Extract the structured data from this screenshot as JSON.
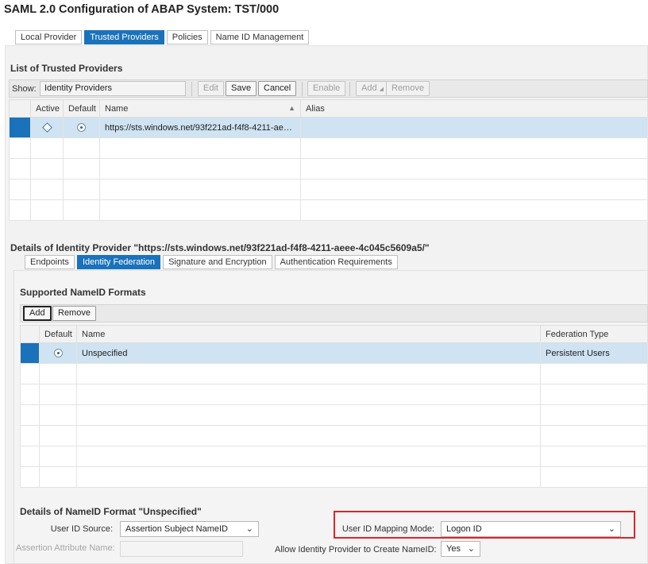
{
  "page_title": "SAML 2.0 Configuration of ABAP System: TST/000",
  "main_tabs": [
    {
      "label": "Local Provider",
      "active": false
    },
    {
      "label": "Trusted Providers",
      "active": true
    },
    {
      "label": "Policies",
      "active": false
    },
    {
      "label": "Name ID Management",
      "active": false
    }
  ],
  "trusted": {
    "title": "List of Trusted Providers",
    "show_label": "Show:",
    "show_value": "Identity Providers",
    "buttons": {
      "edit": "Edit",
      "save": "Save",
      "cancel": "Cancel",
      "enable": "Enable",
      "add": "Add",
      "remove": "Remove"
    },
    "columns": {
      "active": "Active",
      "default": "Default",
      "name": "Name",
      "alias": "Alias"
    },
    "rows": [
      {
        "name": "https://sts.windows.net/93f221ad-f4f8-4211-aeee-4...",
        "alias": ""
      }
    ]
  },
  "details": {
    "title": "Details of Identity Provider \"https://sts.windows.net/93f221ad-f4f8-4211-aeee-4c045c5609a5/\"",
    "tabs": [
      {
        "label": "Endpoints",
        "active": false
      },
      {
        "label": "Identity Federation",
        "active": true
      },
      {
        "label": "Signature and Encryption",
        "active": false
      },
      {
        "label": "Authentication Requirements",
        "active": false
      }
    ]
  },
  "nameid": {
    "title": "Supported NameID Formats",
    "buttons": {
      "add": "Add",
      "remove": "Remove"
    },
    "columns": {
      "default": "Default",
      "name": "Name",
      "federation_type": "Federation Type"
    },
    "rows": [
      {
        "name": "Unspecified",
        "federation_type": "Persistent Users"
      }
    ]
  },
  "format_details": {
    "title": "Details of NameID Format \"Unspecified\"",
    "user_id_source_label": "User ID Source:",
    "user_id_source_value": "Assertion Subject NameID",
    "assertion_attr_label": "Assertion Attribute Name:",
    "mapping_mode_label": "User ID Mapping Mode:",
    "mapping_mode_value": "Logon ID",
    "allow_create_label": "Allow Identity Provider to Create NameID:",
    "allow_create_value": "Yes"
  },
  "colors": {
    "accent": "#1a72bb",
    "selected_row": "#cfe3f2",
    "highlight": "#d9262c"
  }
}
